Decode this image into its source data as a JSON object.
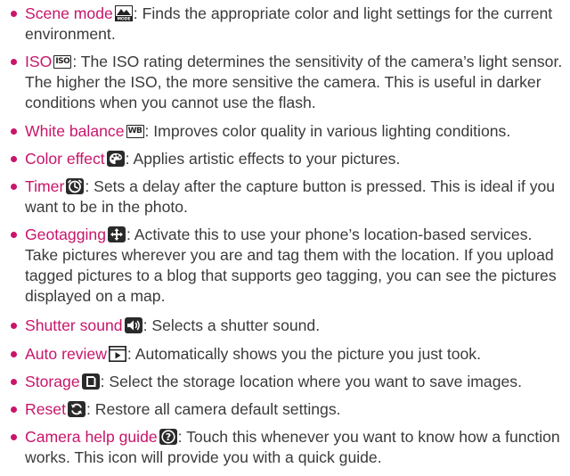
{
  "items": [
    {
      "term": "Scene mode",
      "icon": "scene-mode-icon",
      "desc": ": Finds the appropriate color and light settings for the current environment."
    },
    {
      "term": "ISO",
      "icon": "iso-icon",
      "icon_text": "ISO",
      "desc": ": The ISO rating determines the sensitivity of the camera’s light sensor. The higher the ISO, the more sensitive the camera. This is useful in darker conditions when you cannot use the flash."
    },
    {
      "term": "White balance",
      "icon": "white-balance-icon",
      "icon_text": "WB",
      "desc": ": Improves color quality in various lighting conditions."
    },
    {
      "term": "Color effect",
      "icon": "color-effect-icon",
      "desc": ": Applies artistic effects to your pictures."
    },
    {
      "term": "Timer",
      "icon": "timer-icon",
      "desc": ": Sets a delay after the capture button is pressed. This is ideal if you want to be in the photo."
    },
    {
      "term": "Geotagging",
      "icon": "geotagging-icon",
      "desc": ": Activate this to use your phone’s location-based services. Take pictures wherever you are and tag them with the location. If you upload tagged pictures to a blog that supports geo tagging, you can see the pictures displayed on a map."
    },
    {
      "term": "Shutter sound",
      "icon": "shutter-sound-icon",
      "desc": ": Selects a shutter sound."
    },
    {
      "term": "Auto review",
      "icon": "auto-review-icon",
      "desc": ": Automatically shows you the picture you just took."
    },
    {
      "term": "Storage",
      "icon": "storage-icon",
      "desc": ": Select the storage location where you want to save images."
    },
    {
      "term": "Reset",
      "icon": "reset-icon",
      "desc": ": Restore all camera default settings."
    },
    {
      "term": "Camera help guide",
      "icon": "help-icon",
      "desc": ": Touch this whenever you want to know how a function works. This icon will provide you with a quick guide."
    }
  ],
  "colors": {
    "accent": "#c8156a",
    "text": "#3a3a3a"
  }
}
